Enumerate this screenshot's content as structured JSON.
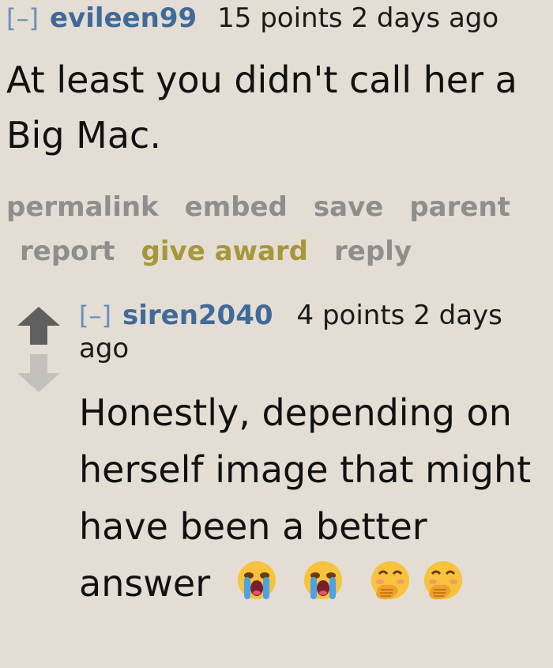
{
  "comment": {
    "collapse_label": "[–]",
    "author": "evileen99",
    "meta": "15 points 2 days ago",
    "body": "At least you didn't call her a Big Mac.",
    "buttons": {
      "permalink": "permalink",
      "embed": "embed",
      "save": "save",
      "parent": "parent",
      "report": "report",
      "give_award": "give award",
      "reply": "reply"
    },
    "colors": {
      "author": "#3f6a9a",
      "buttons": "#8e8e8e",
      "give_award": "#a7973a",
      "background": "#e4ddd3"
    }
  },
  "reply_comment": {
    "collapse_label": "[–]",
    "author": "siren2040",
    "meta": "4 points 2 days ago",
    "body": "Honestly, depending on herself image that might have been a better answer",
    "upvote_icon": "upvote-arrow-icon",
    "downvote_icon": "downvote-arrow-icon",
    "emojis": [
      "loudly-crying-face-emoji",
      "loudly-crying-face-emoji",
      "face-with-hand-over-mouth-emoji",
      "face-with-hand-over-mouth-emoji"
    ]
  }
}
